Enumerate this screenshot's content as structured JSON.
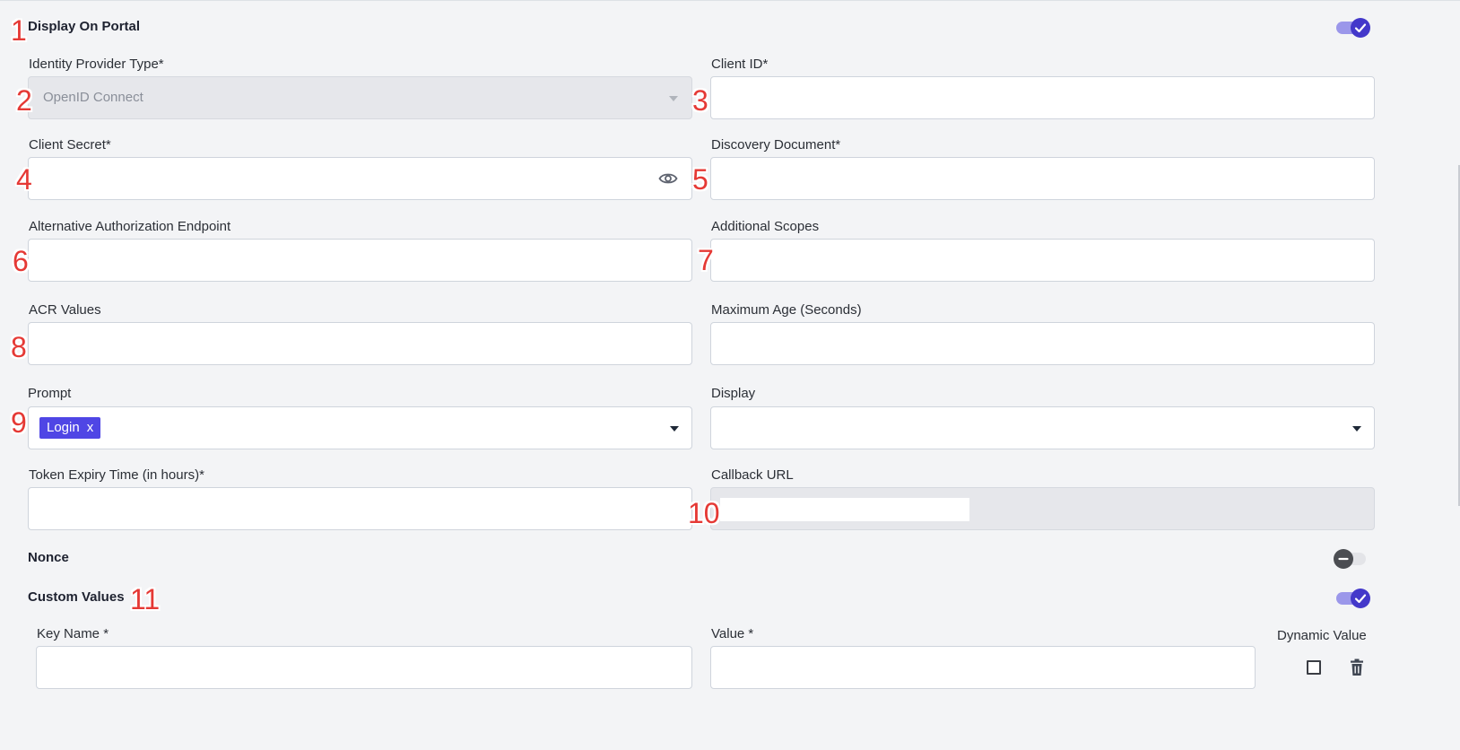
{
  "display_on_portal": {
    "label": "Display On Portal",
    "enabled": true
  },
  "identity_provider_type": {
    "label": "Identity Provider Type*",
    "value": "OpenID Connect"
  },
  "client_id": {
    "label": "Client ID*",
    "value": ""
  },
  "client_secret": {
    "label": "Client Secret*",
    "value": "",
    "icon": "eye-icon"
  },
  "discovery_document": {
    "label": "Discovery Document*",
    "value": ""
  },
  "alt_auth_endpoint": {
    "label": "Alternative Authorization Endpoint",
    "value": ""
  },
  "additional_scopes": {
    "label": "Additional Scopes",
    "value": ""
  },
  "acr_values": {
    "label": "ACR Values",
    "value": ""
  },
  "max_age": {
    "label": "Maximum Age (Seconds)",
    "value": ""
  },
  "prompt": {
    "label": "Prompt",
    "chips": [
      {
        "label": "Login",
        "remove": "x"
      }
    ]
  },
  "display": {
    "label": "Display",
    "value": ""
  },
  "token_expiry": {
    "label": "Token Expiry Time (in hours)*",
    "value": ""
  },
  "callback_url": {
    "label": "Callback URL",
    "value": ""
  },
  "nonce": {
    "label": "Nonce",
    "enabled": false
  },
  "custom_values": {
    "label": "Custom Values",
    "enabled": true,
    "key_name_label": "Key Name *",
    "value_label": "Value *",
    "dynamic_value_label": "Dynamic Value",
    "rows": [
      {
        "key": "",
        "value": "",
        "dynamic": false
      }
    ]
  },
  "annotations": [
    "1",
    "2",
    "3",
    "4",
    "5",
    "6",
    "7",
    "8",
    "9",
    "10",
    "11"
  ],
  "colors": {
    "accent": "#4f46e5",
    "annotation": "#e53935",
    "background": "#f3f4f6"
  }
}
